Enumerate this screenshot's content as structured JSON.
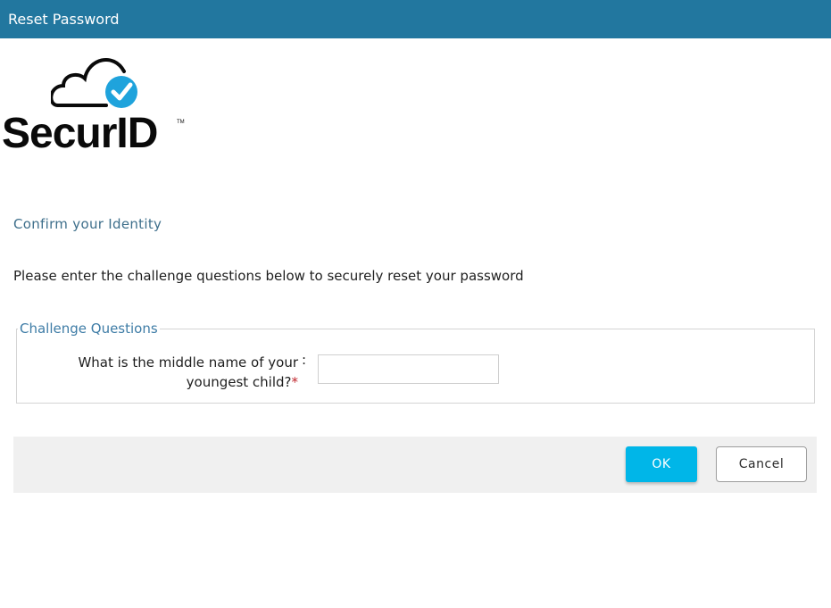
{
  "window": {
    "title": "Reset Password"
  },
  "logo": {
    "text": "SecurID",
    "trademark": "TM",
    "icon": "cloud-checkmark-icon",
    "accent_color": "#1fa3dc"
  },
  "page": {
    "subtitle": "Confirm your Identity",
    "instructions": "Please enter the challenge questions below to securely reset your password"
  },
  "challenge": {
    "legend": "Challenge Questions",
    "question_label": "What is the middle name of your youngest child?",
    "required_marker": "*",
    "separator": ":",
    "answer_value": "",
    "answer_placeholder": ""
  },
  "buttons": {
    "ok_label": "OK",
    "cancel_label": "Cancel"
  },
  "colors": {
    "titlebar": "#22779f",
    "ok_button": "#00b6e8",
    "subtitle": "#3e6f8b",
    "required": "#c0262d"
  }
}
